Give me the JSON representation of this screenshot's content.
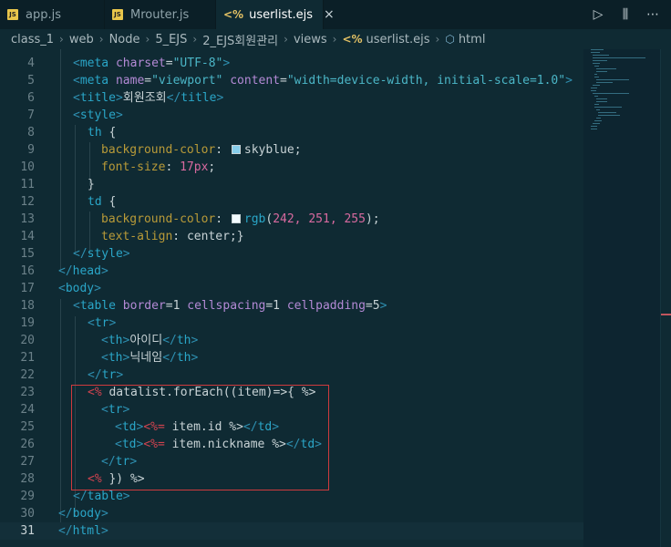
{
  "tabs": [
    {
      "label": "app.js",
      "icon": "js-file-icon",
      "active": false
    },
    {
      "label": "Mrouter.js",
      "icon": "js-file-icon",
      "active": false
    },
    {
      "label": "userlist.ejs",
      "icon": "ejs-file-icon",
      "active": true
    }
  ],
  "tab_actions": {
    "run": "▷",
    "split": "⫼",
    "more": "⋯",
    "close": "×"
  },
  "breadcrumb": [
    "class_1",
    "web",
    "Node",
    "5_EJS",
    "2_EJS회원관리",
    "views",
    "userlist.ejs",
    "html"
  ],
  "editor": {
    "current_line": 31,
    "lines": [
      {
        "n": "4"
      },
      {
        "n": "5"
      },
      {
        "n": "6"
      },
      {
        "n": "7"
      },
      {
        "n": "8"
      },
      {
        "n": "9"
      },
      {
        "n": "10"
      },
      {
        "n": "11"
      },
      {
        "n": "12"
      },
      {
        "n": "13"
      },
      {
        "n": "14"
      },
      {
        "n": "15"
      },
      {
        "n": "16"
      },
      {
        "n": "17"
      },
      {
        "n": "18"
      },
      {
        "n": "19"
      },
      {
        "n": "20"
      },
      {
        "n": "21"
      },
      {
        "n": "22"
      },
      {
        "n": "23"
      },
      {
        "n": "24"
      },
      {
        "n": "25"
      },
      {
        "n": "26"
      },
      {
        "n": "27"
      },
      {
        "n": "28"
      },
      {
        "n": "29"
      },
      {
        "n": "30"
      },
      {
        "n": "31"
      }
    ],
    "code": {
      "l4_charset_attr": "charset",
      "l4_charset_val": "\"UTF-8\"",
      "l5_name_val": "\"viewport\"",
      "l5_content_val": "\"width=device-width, initial-scale=1.0\"",
      "l6_title": "회원조회",
      "th_selector": "th",
      "bg_prop": "background-color",
      "th_bg_value": "skyblue",
      "fs_prop": "font-size",
      "fs_value": "17px",
      "td_selector": "td",
      "td_bg_value": "rgb",
      "td_bg_args": "242, 251, 255",
      "ta_prop": "text-align",
      "ta_value": "center",
      "table_attrs": {
        "border": "1",
        "cellspacing": "1",
        "cellpadding": "5"
      },
      "th1": "아이디",
      "th2": "닉네임",
      "ejs_loop": " datalist.forEach((item)=>{ ",
      "td1_expr": " item.id ",
      "td2_expr": " item.nickname ",
      "ejs_close": " }) "
    },
    "colors": {
      "skyblue": "#87ceeb",
      "td_bg": "#f2fbff",
      "highlight_box": "#cf3a3e"
    }
  }
}
